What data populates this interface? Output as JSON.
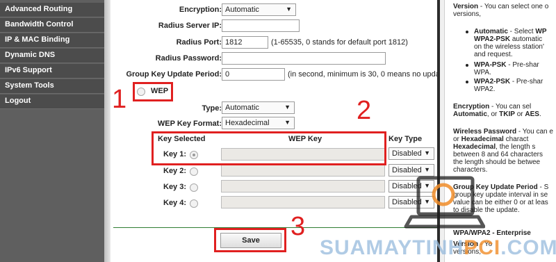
{
  "sidebar": {
    "items": [
      {
        "label": "Advanced Routing"
      },
      {
        "label": "Bandwidth Control"
      },
      {
        "label": "IP & MAC Binding"
      },
      {
        "label": "Dynamic DNS"
      },
      {
        "label": "IPv6 Support"
      },
      {
        "label": "System Tools"
      },
      {
        "label": "Logout"
      }
    ]
  },
  "form": {
    "encryption": {
      "label": "Encryption:",
      "value": "Automatic"
    },
    "radius_server_ip": {
      "label": "Radius Server IP:",
      "value": ""
    },
    "radius_port": {
      "label": "Radius Port:",
      "value": "1812",
      "hint": "(1-65535, 0 stands for default port 1812)"
    },
    "radius_password": {
      "label": "Radius Password:",
      "value": ""
    },
    "group_key_update": {
      "label": "Group Key Update Period:",
      "value": "0",
      "hint": "(in second, minimum is 30, 0 means no upda"
    },
    "wep": {
      "label": "WEP",
      "selected": false
    },
    "type": {
      "label": "Type:",
      "value": "Automatic"
    },
    "wep_key_format": {
      "label": "WEP Key Format:",
      "value": "Hexadecimal"
    },
    "key_table": {
      "headers": {
        "key_selected": "Key Selected",
        "wep_key": "WEP Key",
        "key_type": "Key Type"
      },
      "rows": [
        {
          "label": "Key 1:",
          "selected": true,
          "key": "",
          "type": "Disabled"
        },
        {
          "label": "Key 2:",
          "selected": false,
          "key": "",
          "type": "Disabled"
        },
        {
          "label": "Key 3:",
          "selected": false,
          "key": "",
          "type": "Disabled"
        },
        {
          "label": "Key 4:",
          "selected": false,
          "key": "",
          "type": "Disabled"
        }
      ]
    },
    "save_label": "Save"
  },
  "annotations": {
    "one": "1",
    "two": "2",
    "three": "3"
  },
  "help": {
    "version_intro": [
      "Version",
      " - You can select one o",
      "versions,"
    ],
    "bullets": [
      [
        "Automatic",
        " - Select ",
        "WP"
      ],
      [
        "WPA2-PSK",
        " automatic"
      ],
      [
        "on the wireless station'"
      ],
      [
        "and request."
      ],
      [
        "WPA-PSK",
        " - Pre-shar"
      ],
      [
        "WPA."
      ],
      [
        "WPA2-PSK",
        " - Pre-shar"
      ],
      [
        "WPA2."
      ]
    ],
    "encryption": [
      "Encryption",
      " - You can sel",
      "Automatic",
      ", or ",
      "TKIP",
      " or ",
      "AES",
      "."
    ],
    "wireless_password": [
      "Wireless Password",
      " - You can e",
      "or ",
      "Hexadecimal",
      " charact",
      "Hexadecimal",
      ", the length s",
      "between 8 and 64 characters",
      "the length should be betwee",
      "characters."
    ],
    "group_key": [
      "Group Key Update Period",
      " - S",
      "group key update interval in se",
      "value can be either 0 or at leas",
      "to disable the update."
    ],
    "enterprise_title": "WPA/WPA2 - Enterprise",
    "enterprise_lines": [
      "Version",
      " - Yo",
      "versions,"
    ]
  },
  "watermark": {
    "text_a": "SUAMAYTINH",
    "text_b": "PCI",
    "text_c": ".COM"
  }
}
